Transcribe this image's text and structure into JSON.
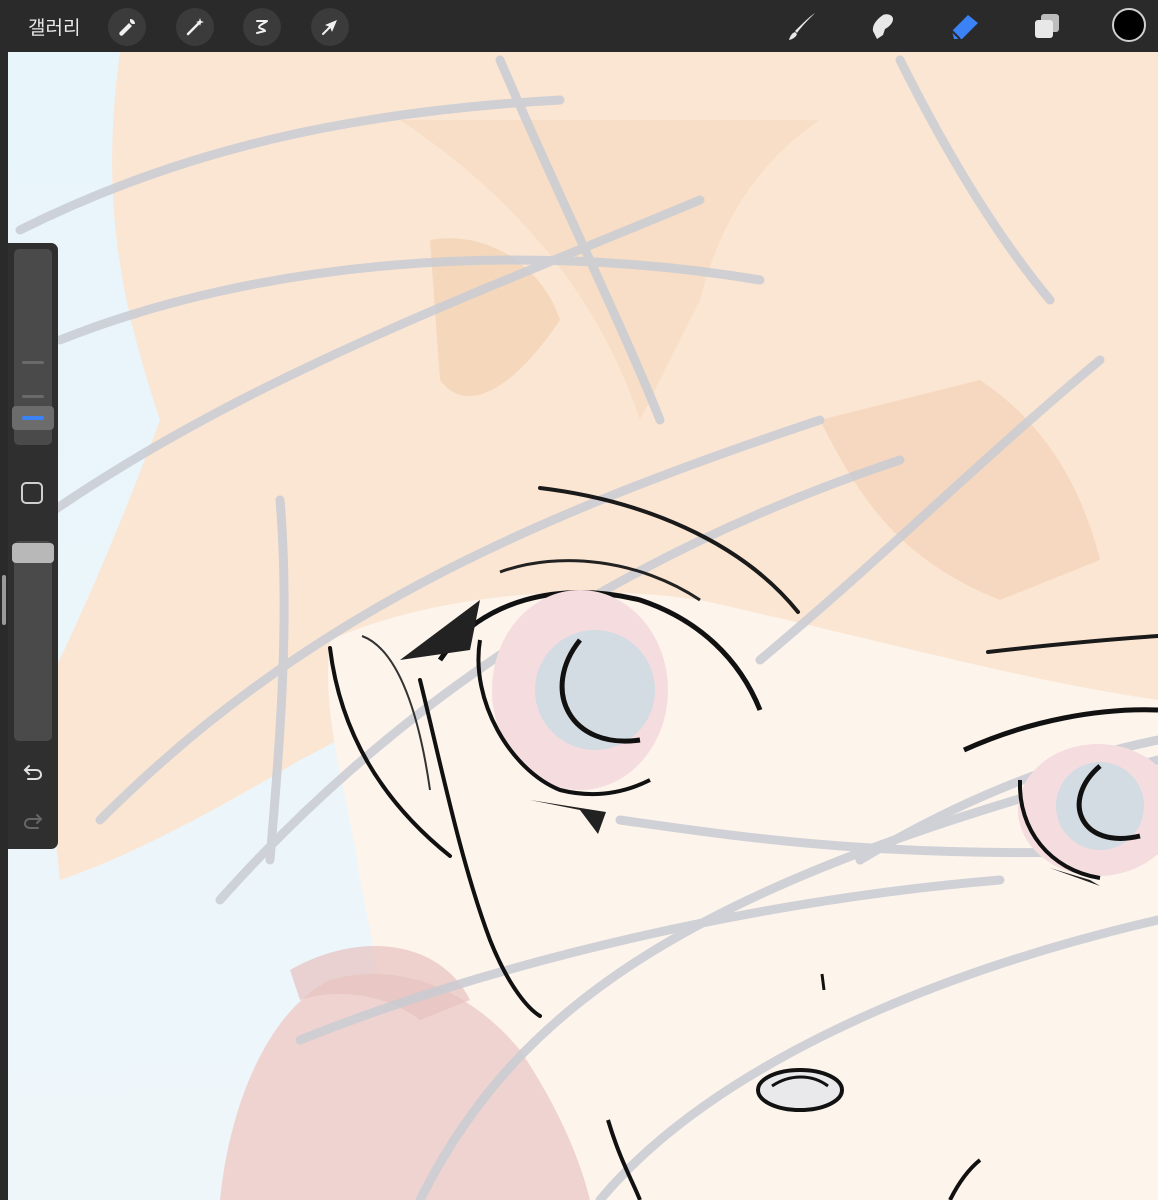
{
  "app": {
    "gallery_label": "갤러리"
  },
  "toolbar": {
    "left_tools": [
      {
        "name": "actions",
        "icon": "wrench-icon"
      },
      {
        "name": "adjustments",
        "icon": "magic-wand-icon"
      },
      {
        "name": "selection",
        "icon": "selection-s-icon"
      },
      {
        "name": "transform",
        "icon": "arrow-cursor-icon"
      }
    ],
    "right_tools": [
      {
        "name": "brush",
        "icon": "brush-icon",
        "active": false
      },
      {
        "name": "smudge",
        "icon": "smudge-finger-icon",
        "active": false
      },
      {
        "name": "eraser",
        "icon": "eraser-icon",
        "active": true
      },
      {
        "name": "layers",
        "icon": "layers-icon",
        "active": false
      }
    ],
    "current_color": "#000000",
    "active_color": "#3a82f6"
  },
  "sidebar": {
    "icons": [
      "undo-icon",
      "redo-icon"
    ]
  }
}
